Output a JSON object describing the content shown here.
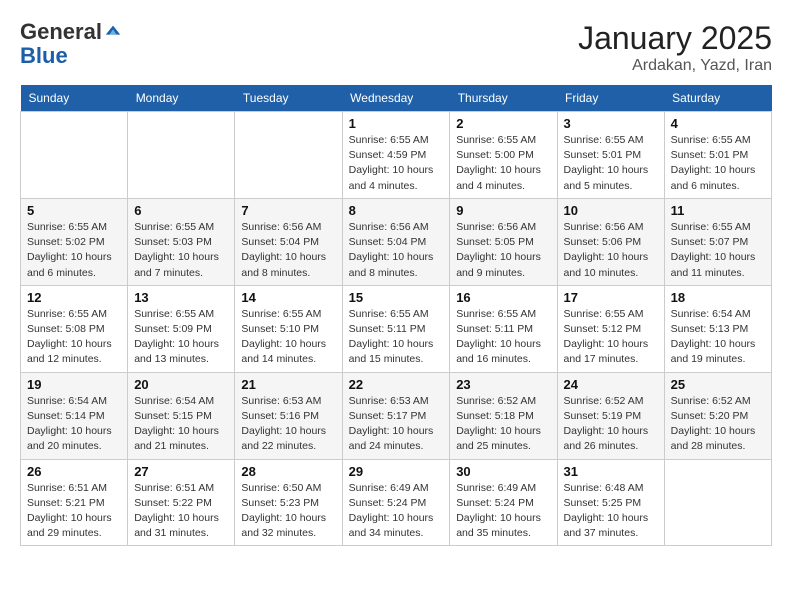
{
  "logo": {
    "general": "General",
    "blue": "Blue"
  },
  "header": {
    "month": "January 2025",
    "location": "Ardakan, Yazd, Iran"
  },
  "days_of_week": [
    "Sunday",
    "Monday",
    "Tuesday",
    "Wednesday",
    "Thursday",
    "Friday",
    "Saturday"
  ],
  "weeks": [
    [
      {
        "day": "",
        "info": ""
      },
      {
        "day": "",
        "info": ""
      },
      {
        "day": "",
        "info": ""
      },
      {
        "day": "1",
        "info": "Sunrise: 6:55 AM\nSunset: 4:59 PM\nDaylight: 10 hours\nand 4 minutes."
      },
      {
        "day": "2",
        "info": "Sunrise: 6:55 AM\nSunset: 5:00 PM\nDaylight: 10 hours\nand 4 minutes."
      },
      {
        "day": "3",
        "info": "Sunrise: 6:55 AM\nSunset: 5:01 PM\nDaylight: 10 hours\nand 5 minutes."
      },
      {
        "day": "4",
        "info": "Sunrise: 6:55 AM\nSunset: 5:01 PM\nDaylight: 10 hours\nand 6 minutes."
      }
    ],
    [
      {
        "day": "5",
        "info": "Sunrise: 6:55 AM\nSunset: 5:02 PM\nDaylight: 10 hours\nand 6 minutes."
      },
      {
        "day": "6",
        "info": "Sunrise: 6:55 AM\nSunset: 5:03 PM\nDaylight: 10 hours\nand 7 minutes."
      },
      {
        "day": "7",
        "info": "Sunrise: 6:56 AM\nSunset: 5:04 PM\nDaylight: 10 hours\nand 8 minutes."
      },
      {
        "day": "8",
        "info": "Sunrise: 6:56 AM\nSunset: 5:04 PM\nDaylight: 10 hours\nand 8 minutes."
      },
      {
        "day": "9",
        "info": "Sunrise: 6:56 AM\nSunset: 5:05 PM\nDaylight: 10 hours\nand 9 minutes."
      },
      {
        "day": "10",
        "info": "Sunrise: 6:56 AM\nSunset: 5:06 PM\nDaylight: 10 hours\nand 10 minutes."
      },
      {
        "day": "11",
        "info": "Sunrise: 6:55 AM\nSunset: 5:07 PM\nDaylight: 10 hours\nand 11 minutes."
      }
    ],
    [
      {
        "day": "12",
        "info": "Sunrise: 6:55 AM\nSunset: 5:08 PM\nDaylight: 10 hours\nand 12 minutes."
      },
      {
        "day": "13",
        "info": "Sunrise: 6:55 AM\nSunset: 5:09 PM\nDaylight: 10 hours\nand 13 minutes."
      },
      {
        "day": "14",
        "info": "Sunrise: 6:55 AM\nSunset: 5:10 PM\nDaylight: 10 hours\nand 14 minutes."
      },
      {
        "day": "15",
        "info": "Sunrise: 6:55 AM\nSunset: 5:11 PM\nDaylight: 10 hours\nand 15 minutes."
      },
      {
        "day": "16",
        "info": "Sunrise: 6:55 AM\nSunset: 5:11 PM\nDaylight: 10 hours\nand 16 minutes."
      },
      {
        "day": "17",
        "info": "Sunrise: 6:55 AM\nSunset: 5:12 PM\nDaylight: 10 hours\nand 17 minutes."
      },
      {
        "day": "18",
        "info": "Sunrise: 6:54 AM\nSunset: 5:13 PM\nDaylight: 10 hours\nand 19 minutes."
      }
    ],
    [
      {
        "day": "19",
        "info": "Sunrise: 6:54 AM\nSunset: 5:14 PM\nDaylight: 10 hours\nand 20 minutes."
      },
      {
        "day": "20",
        "info": "Sunrise: 6:54 AM\nSunset: 5:15 PM\nDaylight: 10 hours\nand 21 minutes."
      },
      {
        "day": "21",
        "info": "Sunrise: 6:53 AM\nSunset: 5:16 PM\nDaylight: 10 hours\nand 22 minutes."
      },
      {
        "day": "22",
        "info": "Sunrise: 6:53 AM\nSunset: 5:17 PM\nDaylight: 10 hours\nand 24 minutes."
      },
      {
        "day": "23",
        "info": "Sunrise: 6:52 AM\nSunset: 5:18 PM\nDaylight: 10 hours\nand 25 minutes."
      },
      {
        "day": "24",
        "info": "Sunrise: 6:52 AM\nSunset: 5:19 PM\nDaylight: 10 hours\nand 26 minutes."
      },
      {
        "day": "25",
        "info": "Sunrise: 6:52 AM\nSunset: 5:20 PM\nDaylight: 10 hours\nand 28 minutes."
      }
    ],
    [
      {
        "day": "26",
        "info": "Sunrise: 6:51 AM\nSunset: 5:21 PM\nDaylight: 10 hours\nand 29 minutes."
      },
      {
        "day": "27",
        "info": "Sunrise: 6:51 AM\nSunset: 5:22 PM\nDaylight: 10 hours\nand 31 minutes."
      },
      {
        "day": "28",
        "info": "Sunrise: 6:50 AM\nSunset: 5:23 PM\nDaylight: 10 hours\nand 32 minutes."
      },
      {
        "day": "29",
        "info": "Sunrise: 6:49 AM\nSunset: 5:24 PM\nDaylight: 10 hours\nand 34 minutes."
      },
      {
        "day": "30",
        "info": "Sunrise: 6:49 AM\nSunset: 5:24 PM\nDaylight: 10 hours\nand 35 minutes."
      },
      {
        "day": "31",
        "info": "Sunrise: 6:48 AM\nSunset: 5:25 PM\nDaylight: 10 hours\nand 37 minutes."
      },
      {
        "day": "",
        "info": ""
      }
    ]
  ]
}
